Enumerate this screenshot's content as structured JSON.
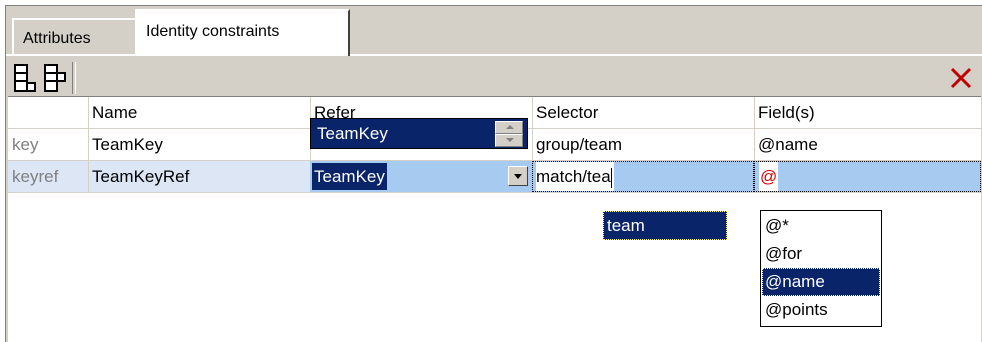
{
  "tabs": [
    {
      "label": "Attributes"
    },
    {
      "label": "Identity constraints"
    }
  ],
  "toolbar": {
    "add_icon": "append-row-icon",
    "insert_icon": "insert-row-icon",
    "delete_icon": "delete-x-icon",
    "delete_color": "#c00000"
  },
  "columns": [
    "",
    "Name",
    "Refer",
    "Selector",
    "Field(s)"
  ],
  "rows": [
    {
      "kind": "key",
      "name": "TeamKey",
      "refer": "",
      "selector": "group/team",
      "fields": "@name"
    },
    {
      "kind": "keyref",
      "name": "TeamKeyRef",
      "refer": "TeamKey",
      "selector": "match/tea",
      "fields": "@"
    }
  ],
  "popups": {
    "refer_options": [
      "TeamKey"
    ],
    "selector_suggestions": [
      "team"
    ],
    "field_options": [
      "@*",
      "@for",
      "@name",
      "@points"
    ],
    "field_selected": "@name"
  },
  "colors": {
    "selection": "#0a246a",
    "row_highlight": "#dce6f4",
    "edit_bg": "#a6caf0",
    "field_error": "#e00000"
  }
}
